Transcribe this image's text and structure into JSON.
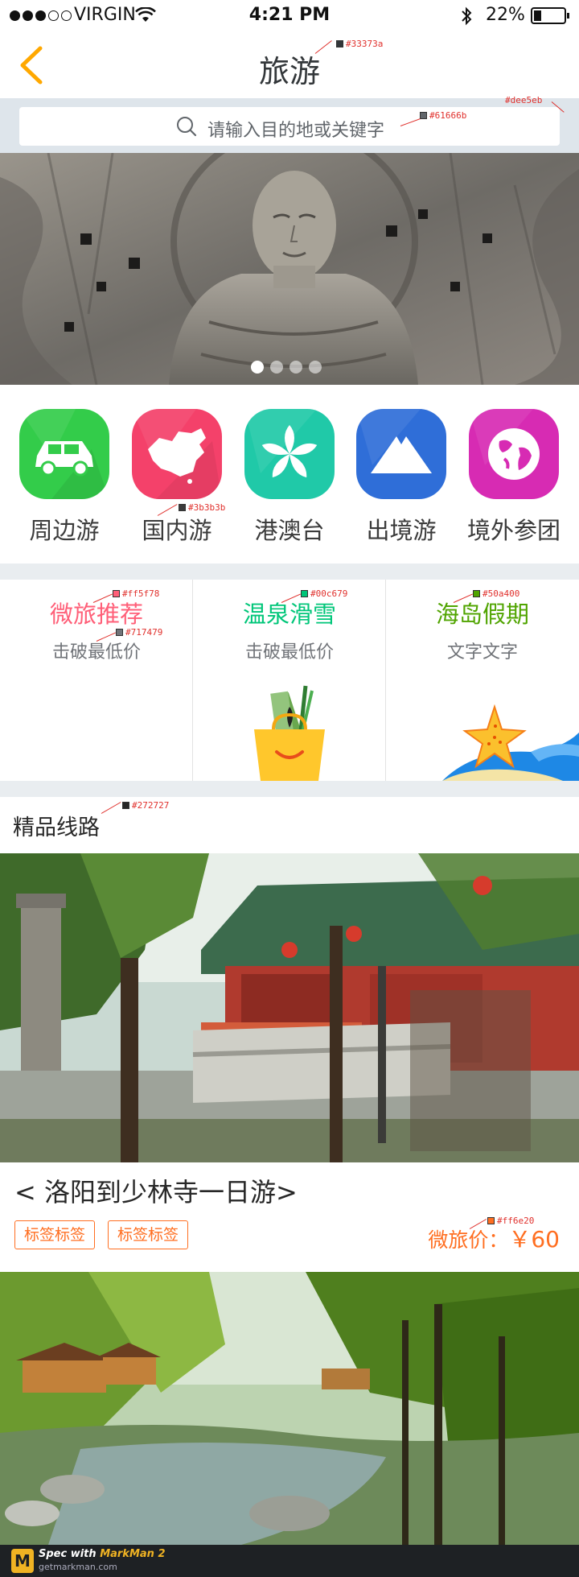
{
  "status": {
    "carrier": "VIRGIN",
    "time": "4:21 PM",
    "battery": "22%"
  },
  "nav": {
    "title": "旅游"
  },
  "search": {
    "placeholder": "请输入目的地或关键字"
  },
  "banner": {
    "pages": 4,
    "active_page": 1
  },
  "categories": [
    {
      "label": "周边游",
      "icon": "car-icon",
      "color": "#33cc4a"
    },
    {
      "label": "国内游",
      "icon": "china-map-icon",
      "color": "#f4416a"
    },
    {
      "label": "港澳台",
      "icon": "bauhinia-flower-icon",
      "color": "#20c9a8"
    },
    {
      "label": "出境游",
      "icon": "mountain-icon",
      "color": "#2f6ed8"
    },
    {
      "label": "境外参团",
      "icon": "globe-icon",
      "color": "#d72bb3"
    }
  ],
  "promos": [
    {
      "title": "微旅推荐",
      "subtitle": "击破最低价",
      "color": "#ff5f78"
    },
    {
      "title": "温泉滑雪",
      "subtitle": "击破最低价",
      "color": "#00c679"
    },
    {
      "title": "海岛假期",
      "subtitle": "文字文字",
      "color": "#50a400"
    }
  ],
  "section": {
    "title": "精品线路"
  },
  "route": {
    "title": "< 洛阳到少林寺一日游>",
    "tags": [
      "标签标签",
      "标签标签"
    ],
    "price_label": "微旅价：",
    "price_value": "￥60"
  },
  "spec_labels": {
    "nav_title": "#33373a",
    "search_bg": "#dee5eb",
    "search_text": "#61666b",
    "category_label": "#3b3b3b",
    "promo1": "#ff5f78",
    "promo_sub": "#717479",
    "promo2": "#00c679",
    "promo3": "#50a400",
    "section_title": "#272727",
    "price": "#ff6e20"
  },
  "footer": {
    "brand_prefix": "Spec with",
    "brand_name": "MarkMan 2",
    "site": "getmarkman.com"
  }
}
